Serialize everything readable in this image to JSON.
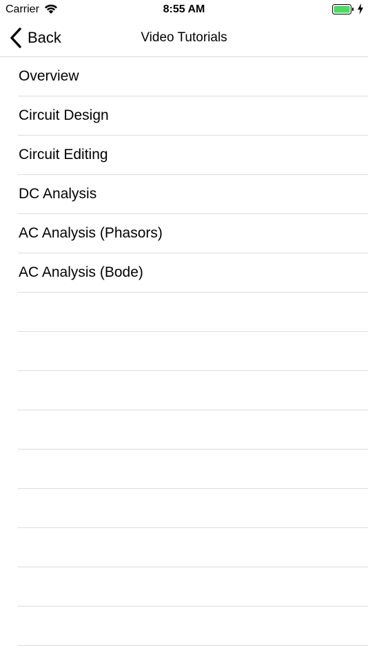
{
  "status_bar": {
    "carrier": "Carrier",
    "time": "8:55 AM",
    "battery_color": "#4cd964"
  },
  "nav": {
    "back_label": "Back",
    "title": "Video Tutorials"
  },
  "tutorials": [
    "Overview",
    "Circuit Design",
    "Circuit Editing",
    "DC Analysis",
    "AC Analysis (Phasors)",
    "AC Analysis (Bode)"
  ],
  "empty_rows": 9
}
